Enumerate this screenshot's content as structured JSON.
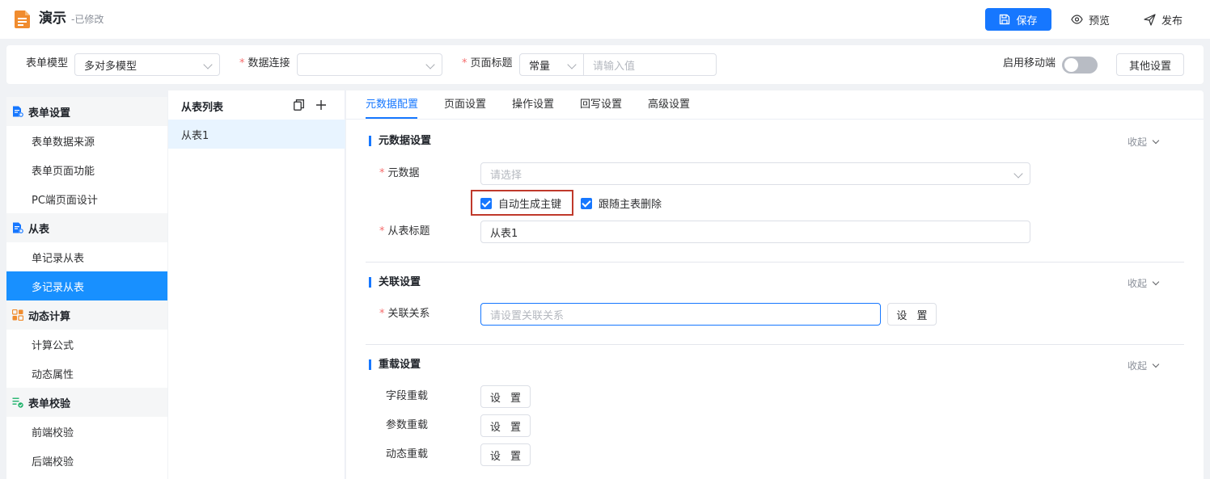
{
  "header": {
    "title": "演示",
    "status": "-已修改",
    "save_label": "保存",
    "preview_label": "预览",
    "publish_label": "发布"
  },
  "filter": {
    "form_model_label": "表单模型",
    "form_model_value": "多对多模型",
    "data_conn_label": "数据连接",
    "data_conn_value": "",
    "page_title_label": "页面标题",
    "page_title_type": "常量",
    "page_title_placeholder": "请输入值",
    "mobile_label": "启用移动端",
    "mobile_enabled": false,
    "other_settings_label": "其他设置"
  },
  "sidebar": {
    "groups": [
      {
        "label": "表单设置",
        "items": [
          "表单数据来源",
          "表单页面功能",
          "PC端页面设计"
        ]
      },
      {
        "label": "从表",
        "items": [
          "单记录从表",
          "多记录从表"
        ]
      },
      {
        "label": "动态计算",
        "items": [
          "计算公式",
          "动态属性"
        ]
      },
      {
        "label": "表单校验",
        "items": [
          "前端校验",
          "后端校验"
        ]
      }
    ],
    "active_item": "多记录从表"
  },
  "sublist": {
    "title": "从表列表",
    "items": [
      "从表1"
    ]
  },
  "tabs": [
    "元数据配置",
    "页面设置",
    "操作设置",
    "回写设置",
    "高级设置"
  ],
  "active_tab": "元数据配置",
  "sections": {
    "metadata": {
      "title": "元数据设置",
      "collapse_label": "收起",
      "metadata_label": "元数据",
      "metadata_placeholder": "请选择",
      "auto_pk_label": "自动生成主键",
      "auto_pk_checked": true,
      "cascade_delete_label": "跟随主表删除",
      "cascade_delete_checked": true,
      "sub_title_label": "从表标题",
      "sub_title_value": "从表1"
    },
    "relation": {
      "title": "关联设置",
      "collapse_label": "收起",
      "relation_label": "关联关系",
      "relation_placeholder": "请设置关联关系",
      "set_label": "设 置"
    },
    "reload": {
      "title": "重载设置",
      "collapse_label": "收起",
      "field_reload_label": "字段重载",
      "param_reload_label": "参数重载",
      "dynamic_reload_label": "动态重载",
      "set_label": "设 置"
    }
  },
  "colors": {
    "primary": "#1677ff",
    "active_sidebar": "#1890ff",
    "required": "#f56c6c",
    "highlight": "#c0392b"
  }
}
